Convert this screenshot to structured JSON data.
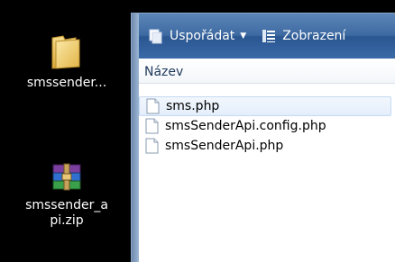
{
  "desktop": {
    "icons": [
      {
        "label": "smssender..."
      },
      {
        "label_line1": "smssender_a",
        "label_line2": "pi.zip"
      }
    ]
  },
  "explorer": {
    "toolbar": {
      "organize_label": "Uspořádat",
      "view_label": "Zobrazení"
    },
    "columns": {
      "name_header": "Název"
    },
    "files": [
      {
        "name": "sms.php"
      },
      {
        "name": "smsSenderApi.config.php"
      },
      {
        "name": "smsSenderApi.php"
      }
    ]
  },
  "colors": {
    "toolbar": "#3d6aa2",
    "selection": "#e4eefb",
    "header_text": "#1e395b"
  }
}
